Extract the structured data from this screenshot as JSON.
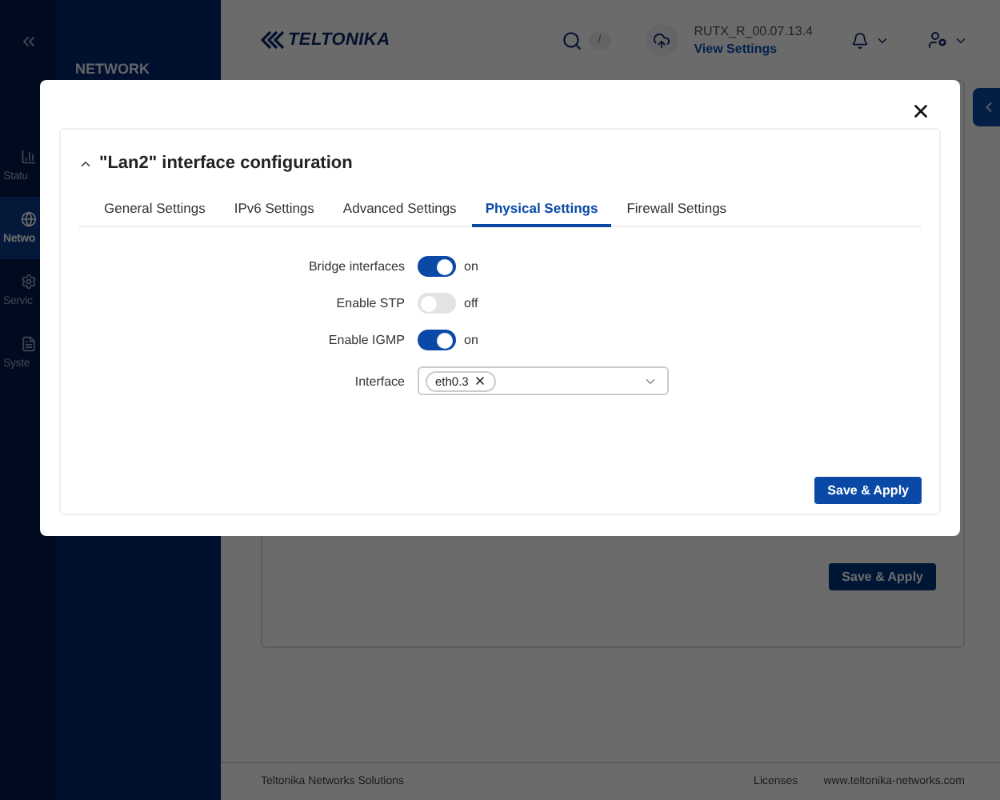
{
  "rail": {
    "items": [
      {
        "label": "Statu",
        "selected": false
      },
      {
        "label": "Netwo",
        "selected": true
      },
      {
        "label": "Servic",
        "selected": false
      },
      {
        "label": "Syste",
        "selected": false
      }
    ]
  },
  "sidebar": {
    "section": "NETWORK"
  },
  "header": {
    "logo": "TELTONIKA",
    "search_key": "/",
    "firmware": "RUTX_R_00.07.13.4",
    "firmware_link": "View Settings"
  },
  "page": {
    "button": "Save & Apply"
  },
  "footer": {
    "company": "Teltonika Networks Solutions",
    "links": [
      "Licenses",
      "www.teltonika-networks.com"
    ]
  },
  "modal": {
    "title": "\"Lan2\" interface configuration",
    "expanded": true,
    "tabs": [
      {
        "label": "General Settings",
        "selected": false
      },
      {
        "label": "IPv6 Settings",
        "selected": false
      },
      {
        "label": "Advanced Settings",
        "selected": false
      },
      {
        "label": "Physical Settings",
        "selected": true
      },
      {
        "label": "Firewall Settings",
        "selected": false
      }
    ],
    "fields": [
      {
        "kind": "toggle",
        "label": "Bridge interfaces",
        "on": true,
        "state_text": "on"
      },
      {
        "kind": "toggle",
        "label": "Enable STP",
        "on": false,
        "state_text": "off"
      },
      {
        "kind": "toggle",
        "label": "Enable IGMP",
        "on": true,
        "state_text": "on"
      },
      {
        "kind": "multiselect",
        "label": "Interface",
        "tags": [
          "eth0.3"
        ]
      }
    ],
    "button": "Save & Apply"
  }
}
